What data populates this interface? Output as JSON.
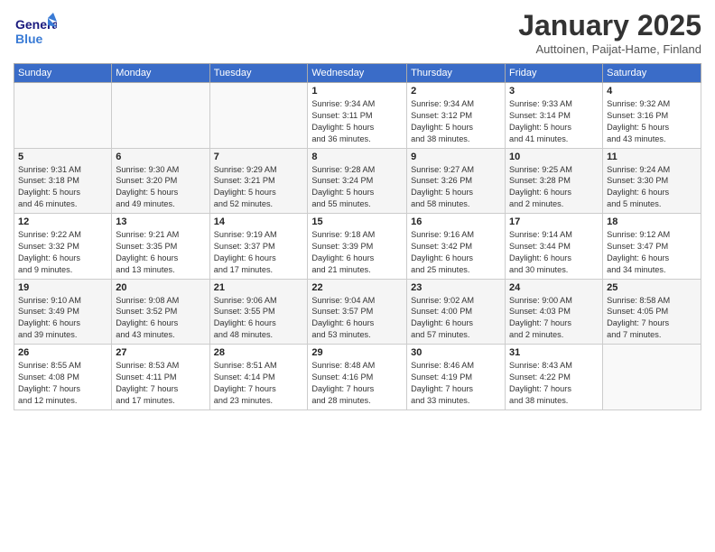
{
  "logo": {
    "line1": "General",
    "line2": "Blue"
  },
  "header": {
    "title": "January 2025",
    "location": "Auttoinen, Paijat-Hame, Finland"
  },
  "weekdays": [
    "Sunday",
    "Monday",
    "Tuesday",
    "Wednesday",
    "Thursday",
    "Friday",
    "Saturday"
  ],
  "weeks": [
    [
      {
        "day": "",
        "info": ""
      },
      {
        "day": "",
        "info": ""
      },
      {
        "day": "",
        "info": ""
      },
      {
        "day": "1",
        "info": "Sunrise: 9:34 AM\nSunset: 3:11 PM\nDaylight: 5 hours\nand 36 minutes."
      },
      {
        "day": "2",
        "info": "Sunrise: 9:34 AM\nSunset: 3:12 PM\nDaylight: 5 hours\nand 38 minutes."
      },
      {
        "day": "3",
        "info": "Sunrise: 9:33 AM\nSunset: 3:14 PM\nDaylight: 5 hours\nand 41 minutes."
      },
      {
        "day": "4",
        "info": "Sunrise: 9:32 AM\nSunset: 3:16 PM\nDaylight: 5 hours\nand 43 minutes."
      }
    ],
    [
      {
        "day": "5",
        "info": "Sunrise: 9:31 AM\nSunset: 3:18 PM\nDaylight: 5 hours\nand 46 minutes."
      },
      {
        "day": "6",
        "info": "Sunrise: 9:30 AM\nSunset: 3:20 PM\nDaylight: 5 hours\nand 49 minutes."
      },
      {
        "day": "7",
        "info": "Sunrise: 9:29 AM\nSunset: 3:21 PM\nDaylight: 5 hours\nand 52 minutes."
      },
      {
        "day": "8",
        "info": "Sunrise: 9:28 AM\nSunset: 3:24 PM\nDaylight: 5 hours\nand 55 minutes."
      },
      {
        "day": "9",
        "info": "Sunrise: 9:27 AM\nSunset: 3:26 PM\nDaylight: 5 hours\nand 58 minutes."
      },
      {
        "day": "10",
        "info": "Sunrise: 9:25 AM\nSunset: 3:28 PM\nDaylight: 6 hours\nand 2 minutes."
      },
      {
        "day": "11",
        "info": "Sunrise: 9:24 AM\nSunset: 3:30 PM\nDaylight: 6 hours\nand 5 minutes."
      }
    ],
    [
      {
        "day": "12",
        "info": "Sunrise: 9:22 AM\nSunset: 3:32 PM\nDaylight: 6 hours\nand 9 minutes."
      },
      {
        "day": "13",
        "info": "Sunrise: 9:21 AM\nSunset: 3:35 PM\nDaylight: 6 hours\nand 13 minutes."
      },
      {
        "day": "14",
        "info": "Sunrise: 9:19 AM\nSunset: 3:37 PM\nDaylight: 6 hours\nand 17 minutes."
      },
      {
        "day": "15",
        "info": "Sunrise: 9:18 AM\nSunset: 3:39 PM\nDaylight: 6 hours\nand 21 minutes."
      },
      {
        "day": "16",
        "info": "Sunrise: 9:16 AM\nSunset: 3:42 PM\nDaylight: 6 hours\nand 25 minutes."
      },
      {
        "day": "17",
        "info": "Sunrise: 9:14 AM\nSunset: 3:44 PM\nDaylight: 6 hours\nand 30 minutes."
      },
      {
        "day": "18",
        "info": "Sunrise: 9:12 AM\nSunset: 3:47 PM\nDaylight: 6 hours\nand 34 minutes."
      }
    ],
    [
      {
        "day": "19",
        "info": "Sunrise: 9:10 AM\nSunset: 3:49 PM\nDaylight: 6 hours\nand 39 minutes."
      },
      {
        "day": "20",
        "info": "Sunrise: 9:08 AM\nSunset: 3:52 PM\nDaylight: 6 hours\nand 43 minutes."
      },
      {
        "day": "21",
        "info": "Sunrise: 9:06 AM\nSunset: 3:55 PM\nDaylight: 6 hours\nand 48 minutes."
      },
      {
        "day": "22",
        "info": "Sunrise: 9:04 AM\nSunset: 3:57 PM\nDaylight: 6 hours\nand 53 minutes."
      },
      {
        "day": "23",
        "info": "Sunrise: 9:02 AM\nSunset: 4:00 PM\nDaylight: 6 hours\nand 57 minutes."
      },
      {
        "day": "24",
        "info": "Sunrise: 9:00 AM\nSunset: 4:03 PM\nDaylight: 7 hours\nand 2 minutes."
      },
      {
        "day": "25",
        "info": "Sunrise: 8:58 AM\nSunset: 4:05 PM\nDaylight: 7 hours\nand 7 minutes."
      }
    ],
    [
      {
        "day": "26",
        "info": "Sunrise: 8:55 AM\nSunset: 4:08 PM\nDaylight: 7 hours\nand 12 minutes."
      },
      {
        "day": "27",
        "info": "Sunrise: 8:53 AM\nSunset: 4:11 PM\nDaylight: 7 hours\nand 17 minutes."
      },
      {
        "day": "28",
        "info": "Sunrise: 8:51 AM\nSunset: 4:14 PM\nDaylight: 7 hours\nand 23 minutes."
      },
      {
        "day": "29",
        "info": "Sunrise: 8:48 AM\nSunset: 4:16 PM\nDaylight: 7 hours\nand 28 minutes."
      },
      {
        "day": "30",
        "info": "Sunrise: 8:46 AM\nSunset: 4:19 PM\nDaylight: 7 hours\nand 33 minutes."
      },
      {
        "day": "31",
        "info": "Sunrise: 8:43 AM\nSunset: 4:22 PM\nDaylight: 7 hours\nand 38 minutes."
      },
      {
        "day": "",
        "info": ""
      }
    ]
  ]
}
